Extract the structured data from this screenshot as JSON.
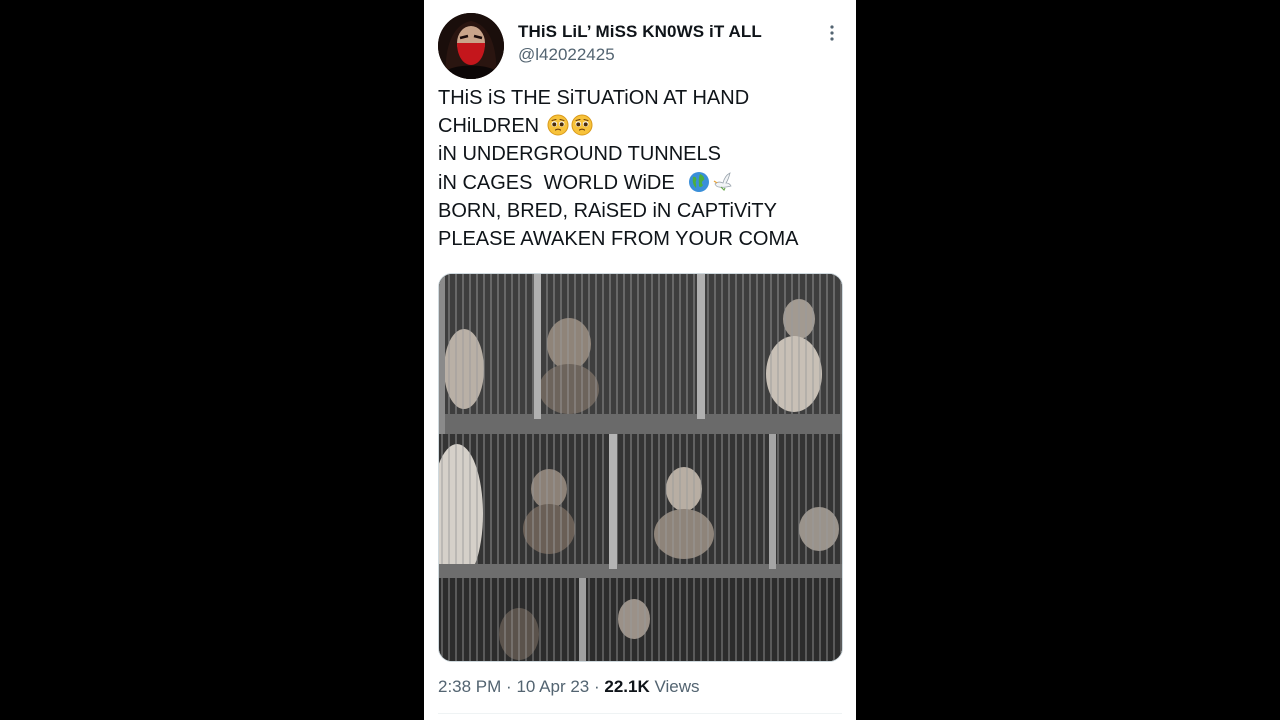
{
  "tweet": {
    "author": {
      "display_name": "THiS LiL’ MiSS KN0WS iT ALL",
      "handle": "@l42022425"
    },
    "text_lines": [
      "THiS iS THE SiTUATiON AT HAND",
      "CHiLDREN",
      "iN UNDERGROUND TUNNELS",
      "iN CAGES  WORLD WiDE",
      "BORN, BRED, RAiSED iN CAPTiViTY",
      "PLEASE AWAKEN FROM YOUR COMA"
    ],
    "emojis": {
      "line2": [
        "pleading-face-emoji",
        "pleading-face-emoji"
      ],
      "line4": [
        "globe-emoji",
        "dove-emoji"
      ]
    },
    "media": {
      "type": "photo"
    },
    "meta": {
      "time": "2:38 PM",
      "separator": "·",
      "date": "10 Apr 23",
      "views_count": "22.1K",
      "views_label": "Views"
    }
  },
  "colors": {
    "background": "#000000",
    "card": "#ffffff",
    "primary_text": "#0f1419",
    "secondary_text": "#536471",
    "border": "#cfd9de"
  }
}
